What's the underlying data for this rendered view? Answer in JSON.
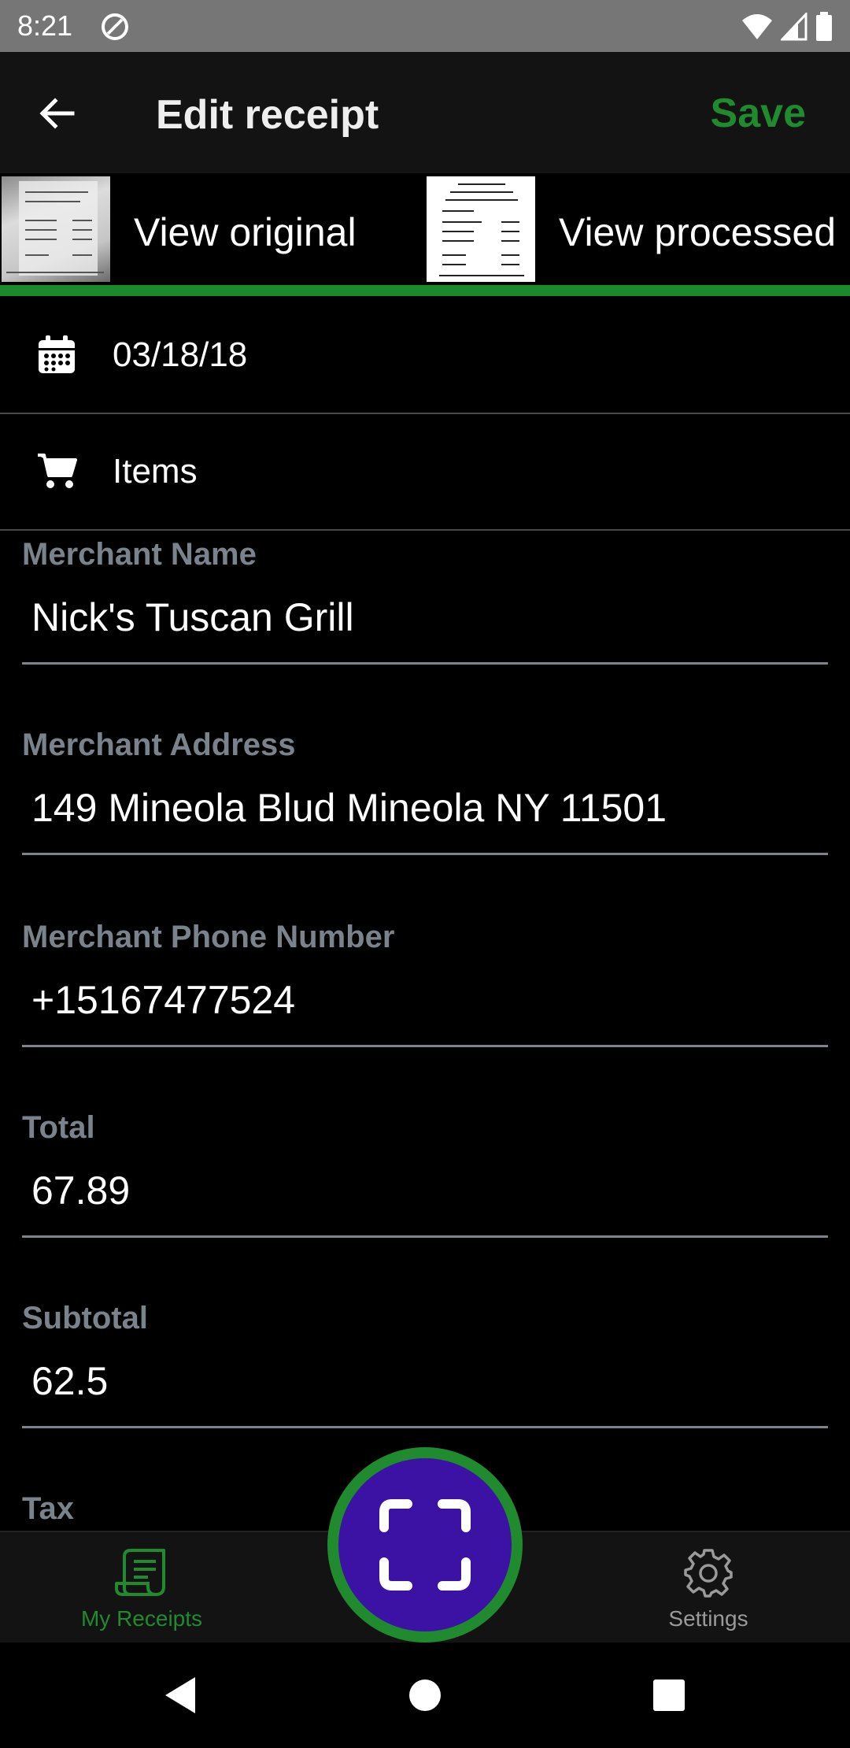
{
  "status_bar": {
    "time": "8:21",
    "left_icon": "data-saver-icon",
    "right_icons": [
      "wifi-icon",
      "signal-icon",
      "battery-icon"
    ]
  },
  "app_bar": {
    "back_icon": "arrow-left-icon",
    "title": "Edit receipt",
    "save_label": "Save"
  },
  "image_tabs": {
    "original_label": "View original",
    "processed_label": "View processed"
  },
  "rows": {
    "date": {
      "icon": "calendar-icon",
      "value": "03/18/18"
    },
    "items": {
      "icon": "cart-icon",
      "label": "Items"
    }
  },
  "fields": [
    {
      "label": "Merchant Name",
      "value": "Nick's Tuscan Grill"
    },
    {
      "label": "Merchant Address",
      "value": "149 Mineola Blud Mineola NY 11501"
    },
    {
      "label": "Merchant Phone Number",
      "value": "+15167477524"
    },
    {
      "label": "Total",
      "value": "67.89"
    },
    {
      "label": "Subtotal",
      "value": "62.5"
    },
    {
      "label": "Tax",
      "value": ""
    }
  ],
  "bottom_nav": {
    "receipts_label": "My Receipts",
    "settings_label": "Settings"
  },
  "colors": {
    "accent_green": "#1f8a2e",
    "fab_purple": "#3b12a3",
    "label_gray": "#7a828c"
  }
}
